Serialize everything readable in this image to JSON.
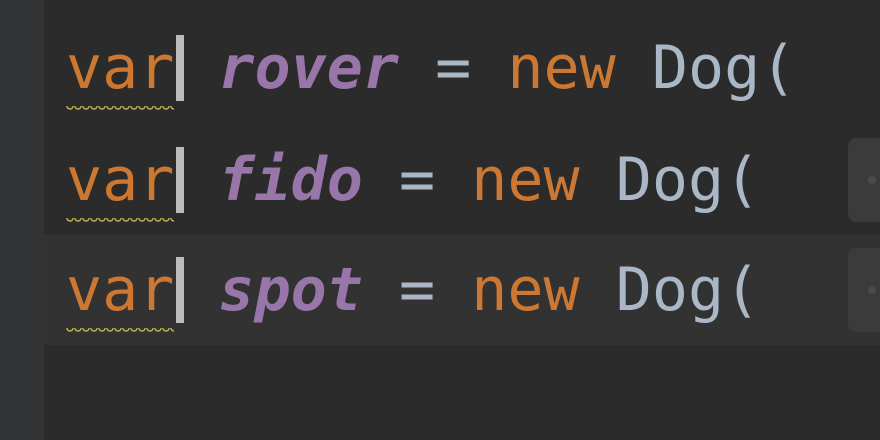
{
  "lines": [
    {
      "keyword": "var",
      "identifier": "rover",
      "operator": "=",
      "new_keyword": "new",
      "class_call": "Dog("
    },
    {
      "keyword": "var",
      "identifier": "fido",
      "operator": "=",
      "new_keyword": "new",
      "class_call": "Dog("
    },
    {
      "keyword": "var",
      "identifier": "spot",
      "operator": "=",
      "new_keyword": "new",
      "class_call": "Dog("
    }
  ],
  "colors": {
    "background": "#2b2b2b",
    "keyword": "#cc7832",
    "identifier": "#9876aa",
    "text": "#a9b7c6",
    "caret": "#bbbbbb",
    "warning_underline": "#b9b04f"
  }
}
